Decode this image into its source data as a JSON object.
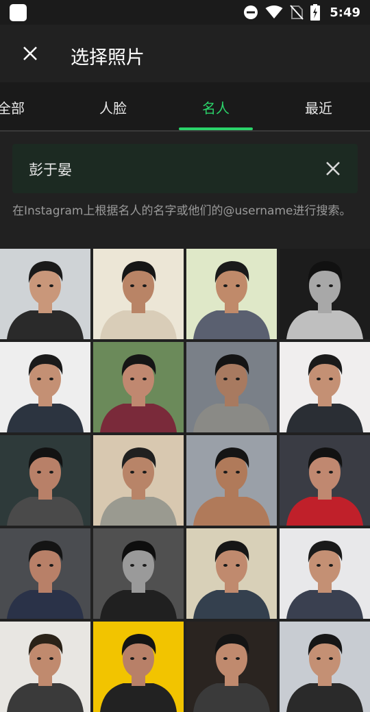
{
  "status_bar": {
    "time": "5:49",
    "icons": [
      "app-icon",
      "dnd-icon",
      "wifi-icon",
      "no-sim-icon",
      "battery-charging-icon"
    ]
  },
  "app_bar": {
    "title": "选择照片",
    "close_icon": "close-icon"
  },
  "tabs": [
    {
      "label": "全部",
      "active": false
    },
    {
      "label": "人脸",
      "active": false
    },
    {
      "label": "名人",
      "active": true
    },
    {
      "label": "最近",
      "active": false
    }
  ],
  "search": {
    "value": "彭于晏",
    "clear_icon": "clear-icon"
  },
  "hint": "在Instagram上根据名人的名字或他们的@username进行搜索。",
  "colors": {
    "accent": "#2bd46a",
    "background": "#212121",
    "search_bg": "#1c2a22"
  },
  "photos": [
    {
      "bg": "#cfd3d6",
      "shirt": "#2a2a2a",
      "skin": "#c9977a",
      "hair": "#1a1a1a"
    },
    {
      "bg": "#ece6d6",
      "shirt": "#d9cdb8",
      "skin": "#b98466",
      "hair": "#161616"
    },
    {
      "bg": "#dfe8c8",
      "shirt": "#5a6070",
      "skin": "#c08a6a",
      "hair": "#1a1a1a"
    },
    {
      "bg": "#1c1c1c",
      "shirt": "#bfbfbf",
      "skin": "#a8a8a8",
      "hair": "#111111"
    },
    {
      "bg": "#eeeeee",
      "shirt": "#2c3440",
      "skin": "#c49074",
      "hair": "#1a1a1a"
    },
    {
      "bg": "#6b8a5a",
      "shirt": "#7a2a3a",
      "skin": "#c08870",
      "hair": "#151515"
    },
    {
      "bg": "#7a8088",
      "shirt": "#8a8a86",
      "skin": "#a87a60",
      "hair": "#141414"
    },
    {
      "bg": "#f0eeee",
      "shirt": "#2a2e34",
      "skin": "#c49074",
      "hair": "#1a1a1a"
    },
    {
      "bg": "#2e3a3a",
      "shirt": "#4a4a4a",
      "skin": "#b88068",
      "hair": "#121212"
    },
    {
      "bg": "#d8c8b0",
      "shirt": "#9a9a90",
      "skin": "#b88468",
      "hair": "#202020"
    },
    {
      "bg": "#9aa0a8",
      "shirt": "#b07a5a",
      "skin": "#b07a5a",
      "hair": "#151515"
    },
    {
      "bg": "#3a3c44",
      "shirt": "#c0202a",
      "skin": "#c08870",
      "hair": "#121212"
    },
    {
      "bg": "#4a4c50",
      "shirt": "#2a3248",
      "skin": "#b88068",
      "hair": "#141414"
    },
    {
      "bg": "#505050",
      "shirt": "#202020",
      "skin": "#9a9a9a",
      "hair": "#0e0e0e"
    },
    {
      "bg": "#d8d0b8",
      "shirt": "#34404e",
      "skin": "#c08a6e",
      "hair": "#161616"
    },
    {
      "bg": "#e8e8ea",
      "shirt": "#3a4050",
      "skin": "#c49074",
      "hair": "#1a1a1a"
    },
    {
      "bg": "#e8e6e2",
      "shirt": "#3a3a3a",
      "skin": "#c08a6e",
      "hair": "#2a2218"
    },
    {
      "bg": "#f2c400",
      "shirt": "#222222",
      "skin": "#b88068",
      "hair": "#141414"
    },
    {
      "bg": "#2a2420",
      "shirt": "#3a3a3a",
      "skin": "#c08a6e",
      "hair": "#141414"
    },
    {
      "bg": "#c8ccd2",
      "shirt": "#2a2a2a",
      "skin": "#c49074",
      "hair": "#161616"
    }
  ]
}
